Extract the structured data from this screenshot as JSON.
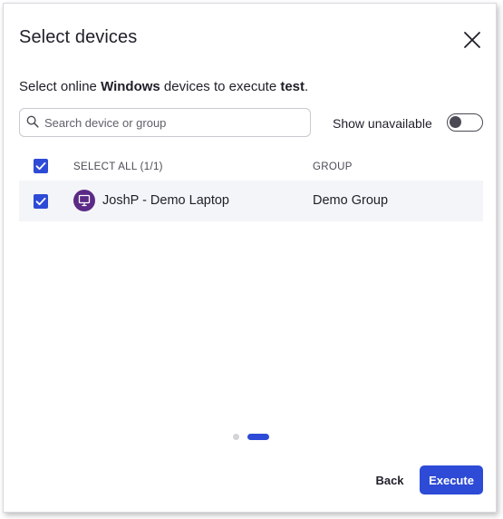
{
  "dialog": {
    "title": "Select devices",
    "subtitle": {
      "prefix": "Select online ",
      "os": "Windows",
      "middle": " devices to execute ",
      "script": "test",
      "suffix": "."
    }
  },
  "search": {
    "value": "",
    "placeholder": "Search device or group"
  },
  "show_unavailable": {
    "label": "Show unavailable",
    "enabled": false
  },
  "table": {
    "headers": {
      "select_all": "SELECT ALL (1/1)",
      "group": "GROUP"
    },
    "select_all_checked": true,
    "rows": [
      {
        "device": "JoshP - Demo Laptop",
        "group": "Demo Group",
        "checked": true
      }
    ]
  },
  "pagination": {
    "current": 2,
    "total": 2
  },
  "footer": {
    "back_label": "Back",
    "execute_label": "Execute"
  },
  "colors": {
    "accent": "#2d4bd6",
    "avatar": "#5b2a86",
    "row_bg": "#f4f5f8"
  }
}
